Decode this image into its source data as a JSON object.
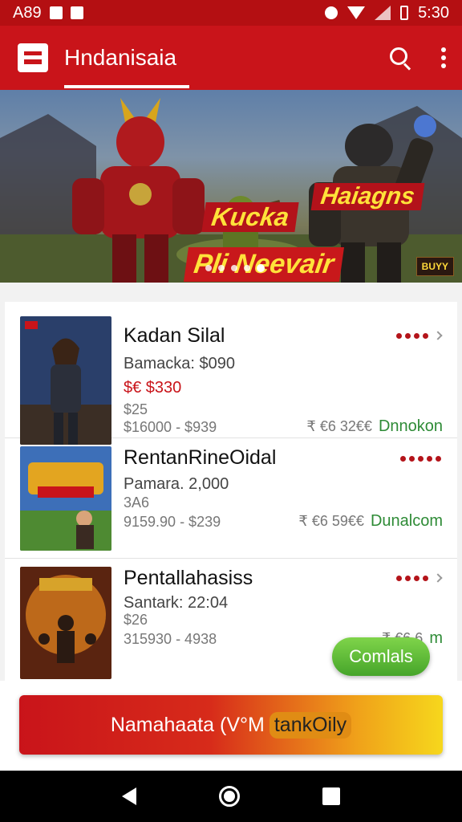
{
  "status_bar": {
    "time_left": "A89",
    "time_right": "5:30"
  },
  "app_bar": {
    "title": "Hndanisaia",
    "icons": [
      "app-logo-icon",
      "search-icon",
      "more-vert-icon"
    ]
  },
  "banner": {
    "headline_1": "Kucka",
    "headline_2": "Haiagns",
    "headline_3": "Pli Neevair",
    "badge": "BUYY",
    "dots_count": 5,
    "active_dot": 4
  },
  "products": [
    {
      "name": "Kadan Silal",
      "subtitle": "Bamacka: $090",
      "price": "$€ $330",
      "small": "$25",
      "range": "$16000 - $939",
      "code": "₹ €6 32€€",
      "status": "Dnnokon"
    },
    {
      "name": "RentanRineOidal",
      "subtitle": "Pamara. 2,000",
      "small": "3A6",
      "range": "9159.90 - $239",
      "code": "₹ €6 59€€",
      "status": "Dunalcom"
    },
    {
      "name": "Pentallahasiss",
      "subtitle": "Santark: 22:04",
      "small": "$26",
      "range": "315930 - 4938",
      "code": "₹ €6 6",
      "status": "m"
    }
  ],
  "compare_button": "Comlals",
  "cta": {
    "label": "Namahaata (V°M",
    "highlight": "tankOily"
  },
  "colors": {
    "primary": "#c9141a",
    "accent": "#f6d71c",
    "success": "#2e8b36"
  }
}
